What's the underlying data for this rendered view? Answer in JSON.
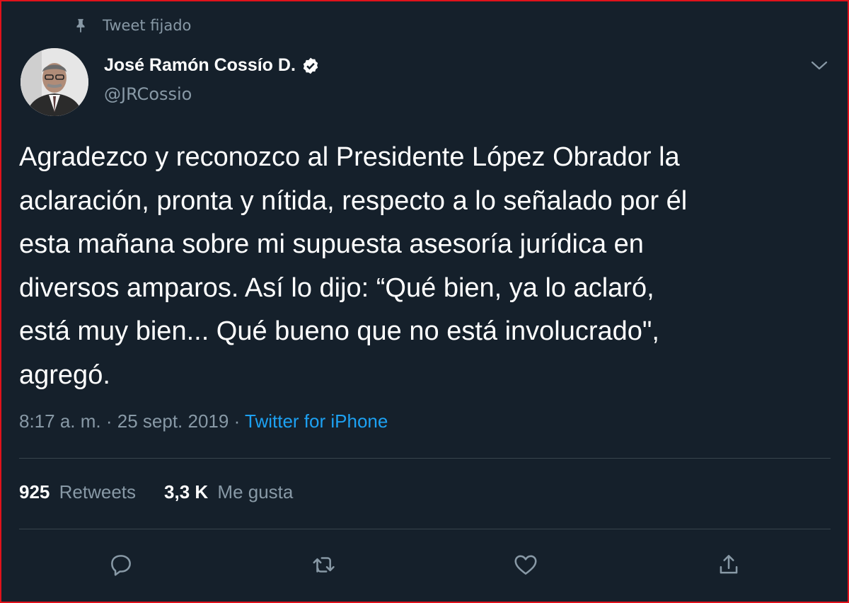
{
  "pinned": {
    "label": "Tweet fijado"
  },
  "author": {
    "name": "José Ramón Cossío D.",
    "handle": "@JRCossio",
    "verified": true
  },
  "tweet": {
    "text": "Agradezco y reconozco al Presidente López Obrador la\naclaración, pronta y nítida, respecto a lo señalado por él\nesta mañana sobre mi supuesta asesoría jurídica en\ndiversos amparos. Así lo dijo: “Qué bien, ya lo aclaró,\nestá muy bien... Qué bueno que no está involucrado\",\nagregó.",
    "time": "8:17 a. m.",
    "separator": "·",
    "date": "25 sept. 2019",
    "source": "Twitter for iPhone"
  },
  "stats": {
    "retweets_count": "925",
    "retweets_label": "Retweets",
    "likes_count": "3,3 K",
    "likes_label": "Me gusta"
  },
  "icons": {
    "pin": "pin-icon",
    "verified": "verified-badge-icon",
    "menu": "chevron-down-icon",
    "reply": "reply-icon",
    "retweet": "retweet-icon",
    "like": "heart-icon",
    "share": "share-icon"
  },
  "colors": {
    "background": "#15202b",
    "secondary_text": "#8899a6",
    "link": "#1da1f2",
    "divider": "#38444d",
    "frame_border": "#e0121b"
  }
}
